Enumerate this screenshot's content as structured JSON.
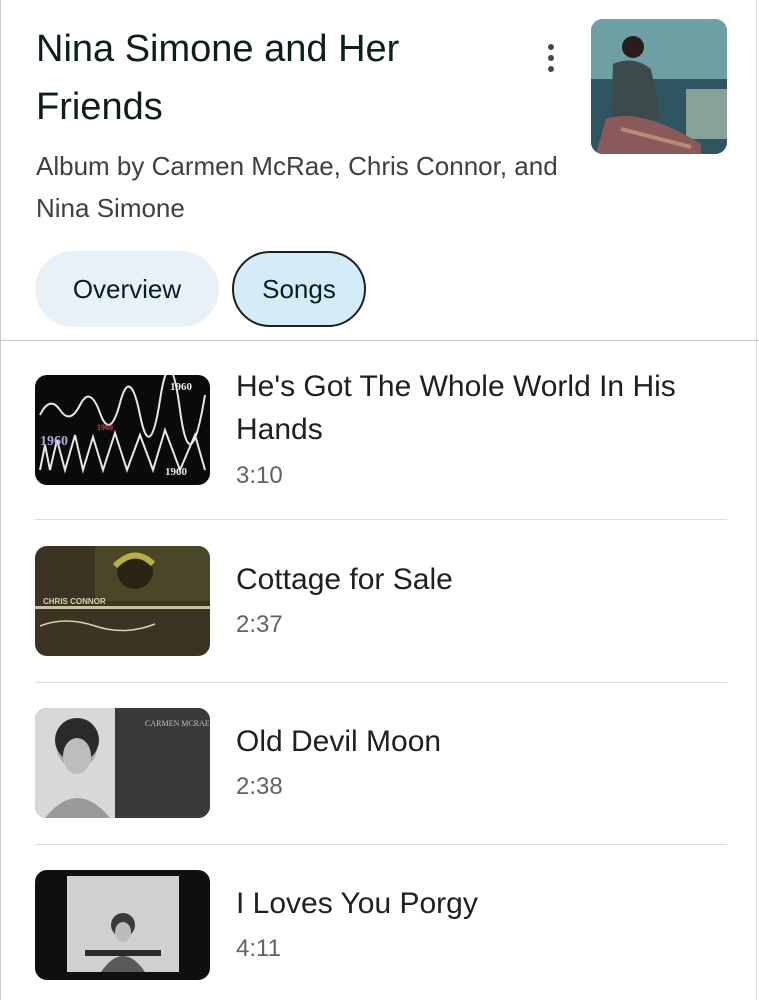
{
  "album": {
    "title": "Nina Simone and Her Friends",
    "subtitle": "Album by Carmen McRae, Chris Connor, and Nina Simone",
    "more_icon": "more-vert-icon"
  },
  "tabs": [
    {
      "label": "Overview",
      "selected": false
    },
    {
      "label": "Songs",
      "selected": true
    }
  ],
  "songs": [
    {
      "title": "He's Got The Whole World In His Hands",
      "duration": "3:10",
      "thumb_text": "1960"
    },
    {
      "title": "Cottage for Sale",
      "duration": "2:37",
      "thumb_text": "CHRIS CONNOR"
    },
    {
      "title": "Old Devil Moon",
      "duration": "2:38",
      "thumb_text": "CARMEN MCRAE"
    },
    {
      "title": "I Loves You Porgy",
      "duration": "4:11",
      "thumb_text": ""
    }
  ],
  "colors": {
    "accent_chip": "#d3ecf8",
    "chip": "#e8f1f7",
    "text": "#1f1f1f",
    "secondary": "#5f6368"
  }
}
